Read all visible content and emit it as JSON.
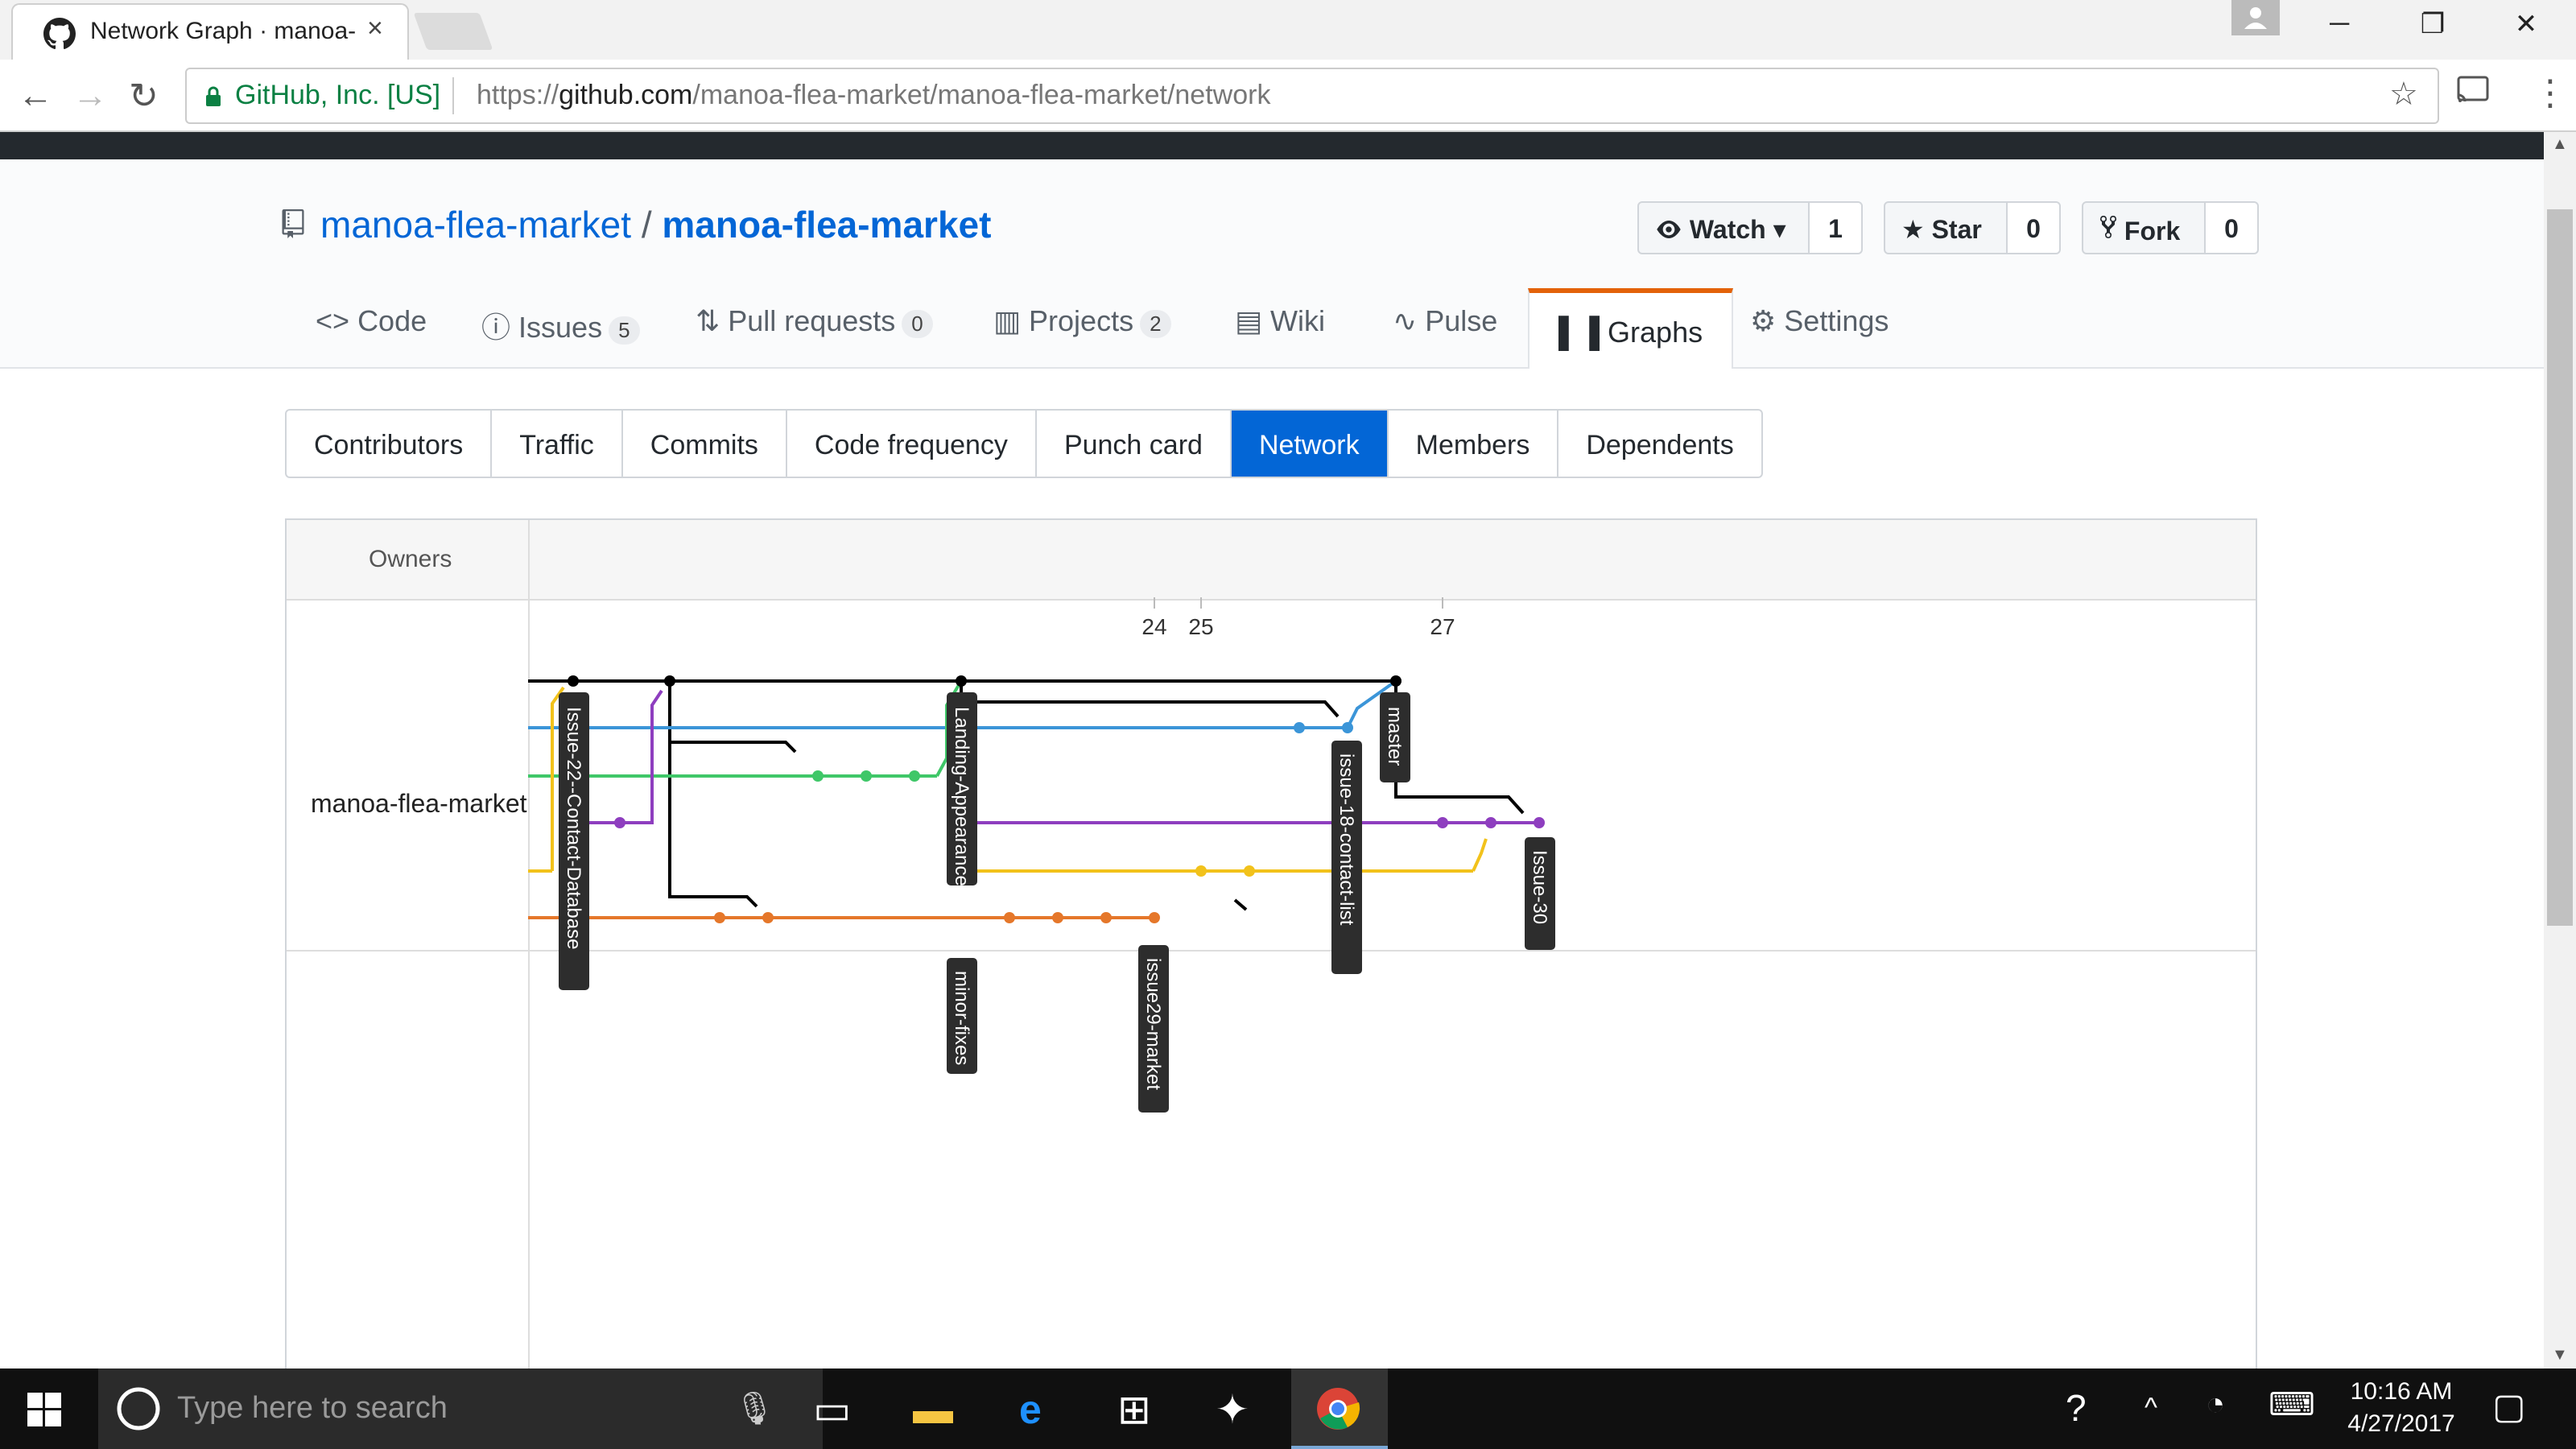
{
  "browser": {
    "tab_title": "Network Graph · manoa-",
    "tab_close": "×",
    "security_label": "GitHub, Inc. [US]",
    "url_scheme": "https://",
    "url_host": "github.com",
    "url_path": "/manoa-flea-market/manoa-flea-market/network"
  },
  "repo": {
    "owner": "manoa-flea-market",
    "separator": "/",
    "name": "manoa-flea-market",
    "watch_label": "Watch ▾",
    "watch_count": "1",
    "star_label": "Star",
    "star_count": "0",
    "fork_label": "Fork",
    "fork_count": "0"
  },
  "repo_tabs": [
    {
      "label": "Code",
      "count": ""
    },
    {
      "label": "Issues",
      "count": "5"
    },
    {
      "label": "Pull requests",
      "count": "0"
    },
    {
      "label": "Projects",
      "count": "2"
    },
    {
      "label": "Wiki",
      "count": ""
    },
    {
      "label": "Pulse",
      "count": ""
    },
    {
      "label": "Graphs",
      "count": "",
      "selected": true
    },
    {
      "label": "Settings",
      "count": ""
    }
  ],
  "graph_tabs": [
    "Contributors",
    "Traffic",
    "Commits",
    "Code frequency",
    "Punch card",
    "Network",
    "Members",
    "Dependents"
  ],
  "graph_tabs_selected": "Network",
  "network": {
    "owners_header": "Owners",
    "owner": "manoa-flea-market",
    "dates": [
      "24",
      "25",
      "27"
    ],
    "branches": [
      "Issue-22--Contact-Database",
      "Landing-Appearance",
      "minor-fixes",
      "issue29-market",
      "issue-18-contact-list",
      "master",
      "Issue-30"
    ],
    "colors": {
      "black": "#000000",
      "blue": "#3b95d8",
      "green": "#3fc768",
      "purple": "#8e3ebf",
      "yellow": "#f2c21b",
      "orange": "#e5772a"
    }
  },
  "taskbar": {
    "search_placeholder": "Type here to search",
    "time": "10:16 AM",
    "date": "4/27/2017"
  }
}
